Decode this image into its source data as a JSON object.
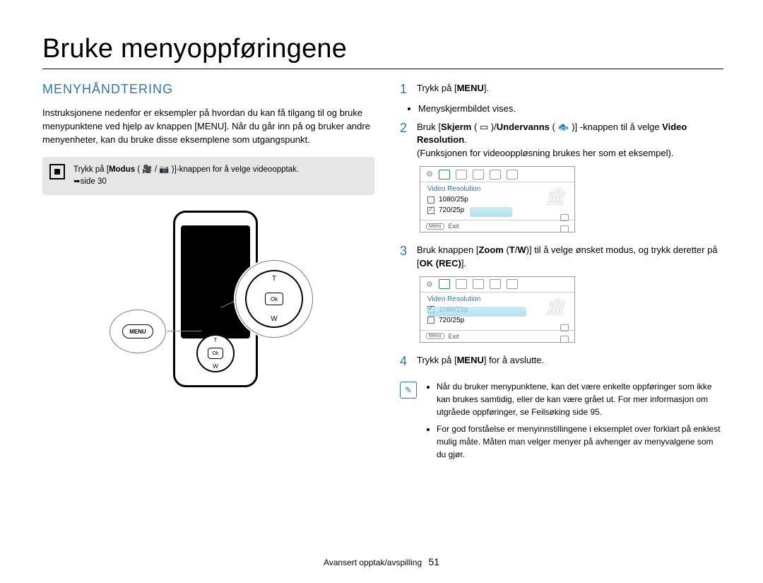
{
  "page_title": "Bruke menyoppføringene",
  "section_heading": "MENYHÅNDTERING",
  "intro_para": "Instruksjonene nedenfor er eksempler på hvordan du kan få tilgang til og bruke menypunktene ved hjelp av knappen [MENU]. Når du går inn på og bruker andre menyenheter, kan du bruke disse eksemplene som utgangspunkt.",
  "tip_line1_pre": "Trykk på [",
  "tip_line1_bold": "Modus",
  "tip_line1_post": " ( 🎥 / 📷 )]-knappen for å velge videoopptak.",
  "tip_line2": "➥side 30",
  "steps": {
    "s1": {
      "num": "1",
      "pre": "Trykk på [",
      "b1": "MENU",
      "post": "]."
    },
    "s1_sub": "Menyskjermbildet vises.",
    "s2": {
      "num": "2",
      "pre": "Bruk [",
      "b1": "Skjerm",
      "mid1": " ( ▭ )/",
      "b2": "Undervanns",
      "mid2": " ( 🐟 )] -knappen til å velge ",
      "b3": "Video Resolution",
      "post2": "."
    },
    "s2_extra": "(Funksjonen for videooppløsning brukes her som et eksempel).",
    "s3": {
      "num": "3",
      "pre": "Bruk knappen [",
      "b1": "Zoom",
      "mid": " (",
      "b2": "T",
      "slash": "/",
      "b3": "W",
      "post": ")] til å velge ønsket modus, og trykk deretter på [",
      "b4": "OK (REC)",
      "post2": "]."
    },
    "s4": {
      "num": "4",
      "pre": "Trykk på [",
      "b1": "MENU",
      "post": "] for å avslutte."
    }
  },
  "screenshot": {
    "title": "Video Resolution",
    "opt1": "1080/25p",
    "opt2": "720/25p",
    "footer_btn": "Menu",
    "footer_text": "Exit"
  },
  "notes": {
    "n1": "Når du bruker menypunktene, kan det være enkelte oppføringer som ikke kan brukes samtidig, eller de kan være grået ut. For mer informasjon om utgråede oppføringer, se Feilsøking side 95.",
    "n2": "For god forståelse er menyinnstillingene i eksemplet over forklart på enklest mulig måte. Måten man velger menyer på avhenger av menyvalgene som du gjør."
  },
  "device": {
    "menu_label": "MENU",
    "ok_label": "Ok"
  },
  "footer": {
    "section": "Avansert opptak/avspilling",
    "page": "51"
  }
}
